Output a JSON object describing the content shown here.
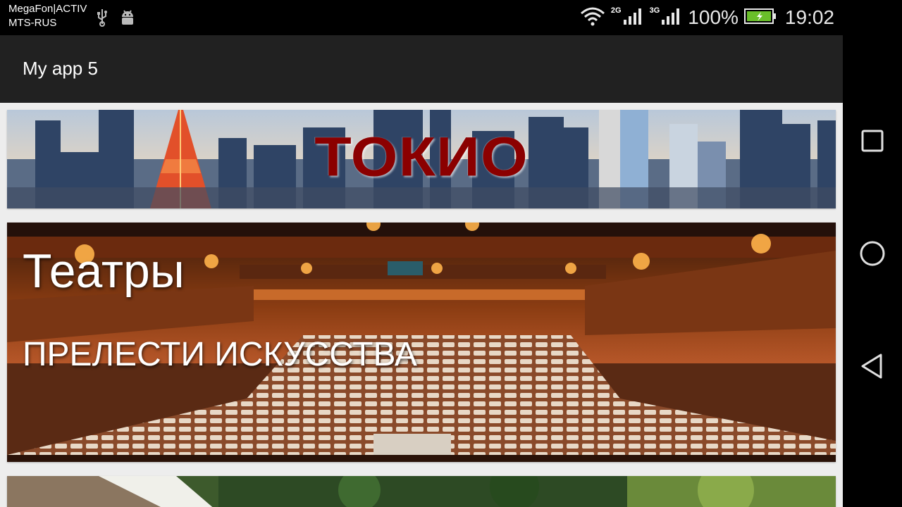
{
  "status_bar": {
    "carrier_line1": "MegaFon|ACTIV",
    "carrier_line2": "MTS-RUS",
    "net1": "2G",
    "net1_sub": "R",
    "net2": "3G",
    "battery": "100%",
    "time": "19:02",
    "icons": [
      "usb-icon",
      "android-debug-icon",
      "wifi-icon",
      "signal-icon",
      "battery-icon"
    ]
  },
  "app_bar": {
    "title": "My app 5"
  },
  "cards": {
    "tokyo": {
      "title": "ТОКИО"
    },
    "theatres": {
      "title": "Театры",
      "subtitle": "ПРЕЛЕСТИ ИСКУССТВА"
    }
  },
  "colors": {
    "accent": "#8b0000",
    "app_bar": "#212121",
    "background": "#ededed"
  }
}
